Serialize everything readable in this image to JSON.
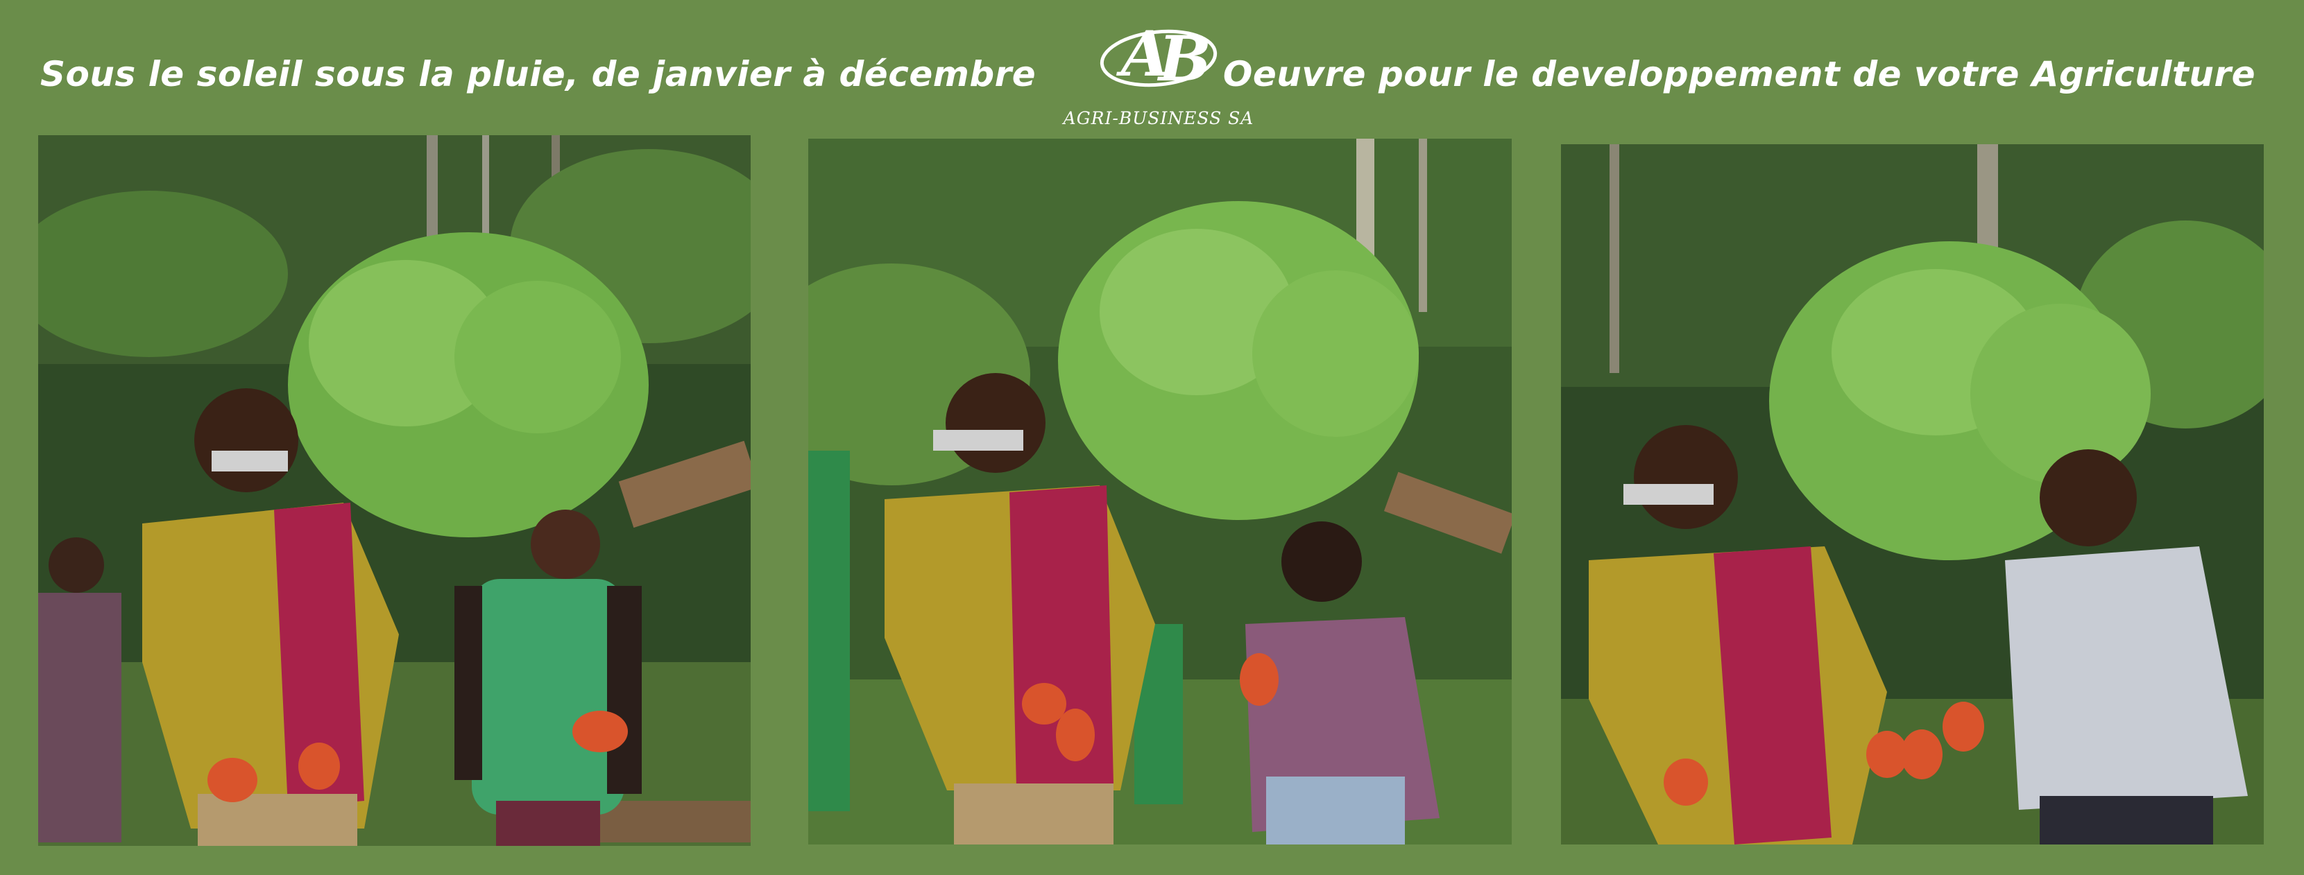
{
  "header": {
    "slogan_left": "Sous le soleil sous la pluie, de janvier à décembre",
    "slogan_right": "Oeuvre pour le developpement de votre Agriculture",
    "logo": {
      "caption": "AGRI-BUSINESS SA"
    }
  },
  "colors": {
    "background": "#6a8d4a",
    "text": "#ffffff",
    "shirt_yellow": "#b39a2a",
    "shirt_pattern": "#a8224a",
    "cocoa_pod": "#d9542c",
    "foliage": "#5e9a3a"
  },
  "photos": [
    {
      "icon": "cocoa-farm-photo-1"
    },
    {
      "icon": "cocoa-farm-photo-2"
    },
    {
      "icon": "cocoa-farm-photo-3"
    }
  ]
}
